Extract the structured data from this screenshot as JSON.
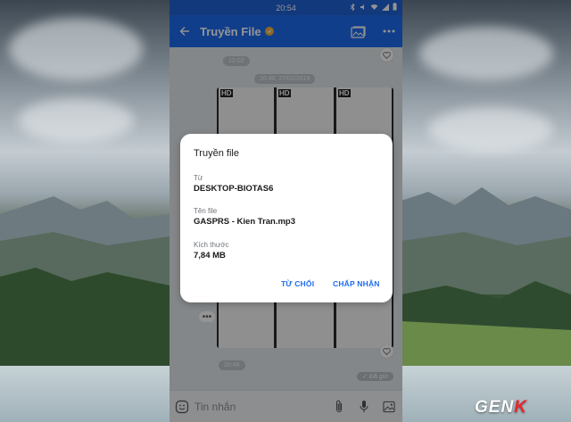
{
  "status_bar": {
    "time": "20:54"
  },
  "app_bar": {
    "title": "Truyền File"
  },
  "chat": {
    "timestamps": [
      "12:02",
      "20:40, 27/01/2019",
      "20:48"
    ],
    "sent_status": "✓ Đã gửi",
    "thumb_badge": "HD"
  },
  "composer": {
    "placeholder": "Tin nhắn"
  },
  "dialog": {
    "title": "Truyền file",
    "fields": [
      {
        "label": "Từ",
        "value": "DESKTOP-BIOTAS6"
      },
      {
        "label": "Tên file",
        "value": "GASPRS - Kien Tran.mp3"
      },
      {
        "label": "Kích thước",
        "value": "7,84 MB"
      }
    ],
    "reject_label": "TỪ CHỐI",
    "accept_label": "CHẤP NHẬN"
  },
  "watermark": {
    "text_main": "GEN",
    "text_accent": "K"
  },
  "colors": {
    "brand_blue": "#1e6cf0",
    "status_bar_blue": "#1f62d6",
    "verified_badge": "#f2b23a"
  },
  "icons": [
    "back-arrow-icon",
    "verified-badge-icon",
    "gallery-icon",
    "more-icon",
    "heart-icon",
    "emoji-icon",
    "attach-icon",
    "mic-icon",
    "image-icon"
  ]
}
